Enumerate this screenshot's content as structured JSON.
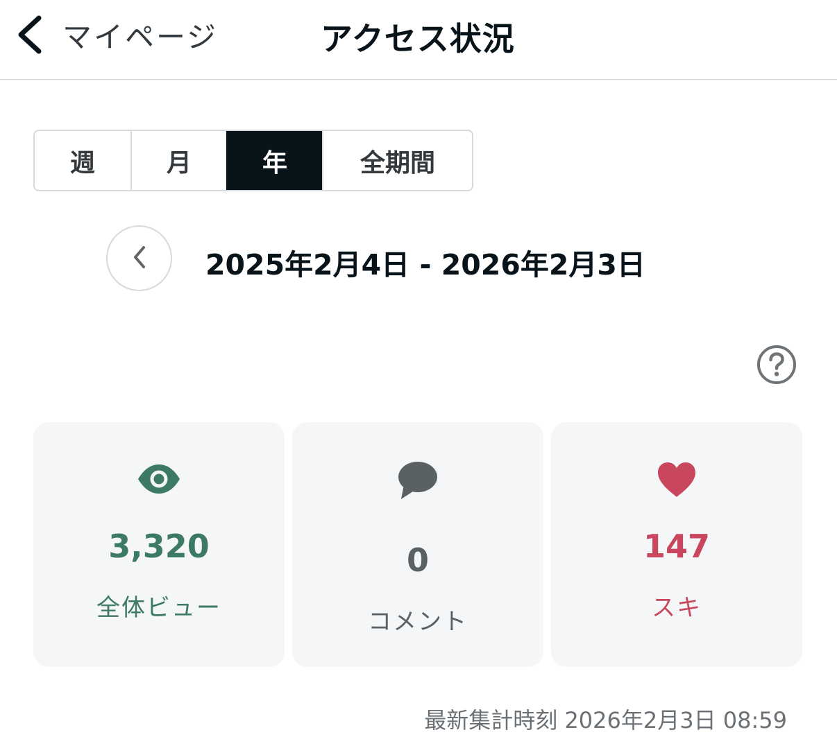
{
  "header": {
    "back_label": "マイページ",
    "title": "アクセス状況"
  },
  "period_tabs": [
    {
      "label": "週",
      "active": false
    },
    {
      "label": "月",
      "active": false
    },
    {
      "label": "年",
      "active": true
    },
    {
      "label": "全期間",
      "active": false
    }
  ],
  "date_range": "2025年2月4日 - 2026年2月3日",
  "icons": {
    "back": "chevron-left-icon",
    "prev": "chevron-left-icon",
    "help": "question-circle-icon",
    "views": "eye-icon",
    "comments": "speech-bubble-icon",
    "likes": "heart-icon"
  },
  "stats": {
    "views": {
      "value": "3,320",
      "label": "全体ビュー",
      "color": "#3d7a63"
    },
    "comments": {
      "value": "0",
      "label": "コメント",
      "color": "#5a6165"
    },
    "likes": {
      "value": "147",
      "label": "スキ",
      "color": "#c9475e"
    }
  },
  "last_updated": "最新集計時刻 2026年2月3日 08:59"
}
